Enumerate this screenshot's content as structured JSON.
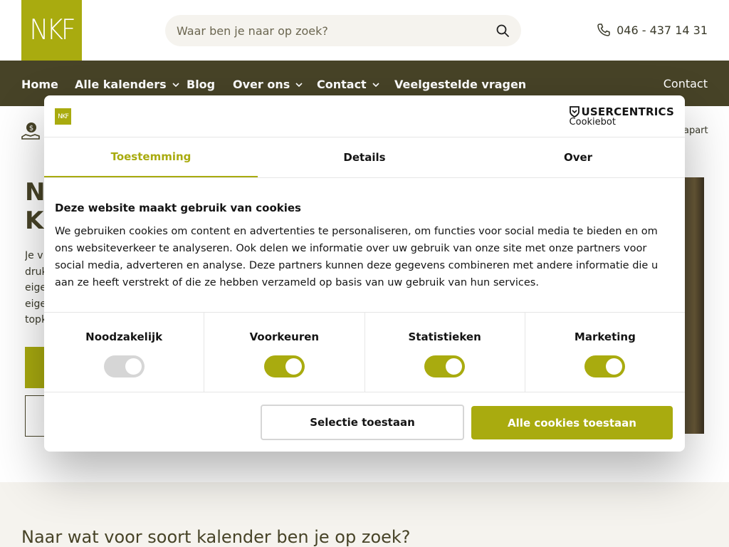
{
  "header": {
    "logo_text": "NKF",
    "search_placeholder": "Waar ben je naar op zoek?",
    "phone": "046 - 437 14 31"
  },
  "nav": {
    "items": [
      {
        "label": "Home",
        "has_dropdown": false
      },
      {
        "label": "Alle kalenders",
        "has_dropdown": true
      },
      {
        "label": "Blog",
        "has_dropdown": false
      },
      {
        "label": "Over ons",
        "has_dropdown": true
      },
      {
        "label": "Contact",
        "has_dropdown": true
      },
      {
        "label": "Veelgestelde vragen",
        "has_dropdown": false
      }
    ],
    "contact_right": "Contact"
  },
  "page": {
    "usp_right_fragment": "apart",
    "hero_title_fragment": "N\nK",
    "hero_para_fragment": "Je v\ndruk\neige\neige\ntopk",
    "section_title": "Naar wat voor soort kalender ben je op zoek?"
  },
  "cookie_dialog": {
    "mini_logo_text": "NKF",
    "brand_name": "USERCENTRICS",
    "brand_sub": "Cookiebot",
    "tabs": [
      {
        "label": "Toestemming",
        "active": true
      },
      {
        "label": "Details",
        "active": false
      },
      {
        "label": "Over",
        "active": false
      }
    ],
    "heading": "Deze website maakt gebruik van cookies",
    "body": "We gebruiken cookies om content en advertenties te personaliseren, om functies voor social media te bieden en om ons websiteverkeer te analyseren. Ook delen we informatie over uw gebruik van onze site met onze partners voor social media, adverteren en analyse. Deze partners kunnen deze gegevens combineren met andere informatie die u aan ze heeft verstrekt of die ze hebben verzameld op basis van uw gebruik van hun services.",
    "categories": [
      {
        "label": "Noodzakelijk",
        "enabled": true,
        "locked": true
      },
      {
        "label": "Voorkeuren",
        "enabled": true,
        "locked": false
      },
      {
        "label": "Statistieken",
        "enabled": true,
        "locked": false
      },
      {
        "label": "Marketing",
        "enabled": true,
        "locked": false
      }
    ],
    "btn_selection": "Selectie toestaan",
    "btn_allow_all": "Alle cookies toestaan"
  },
  "colors": {
    "accent": "#a9ab0f",
    "nav_bg": "#474327",
    "light_bg": "#f5f3ee"
  }
}
